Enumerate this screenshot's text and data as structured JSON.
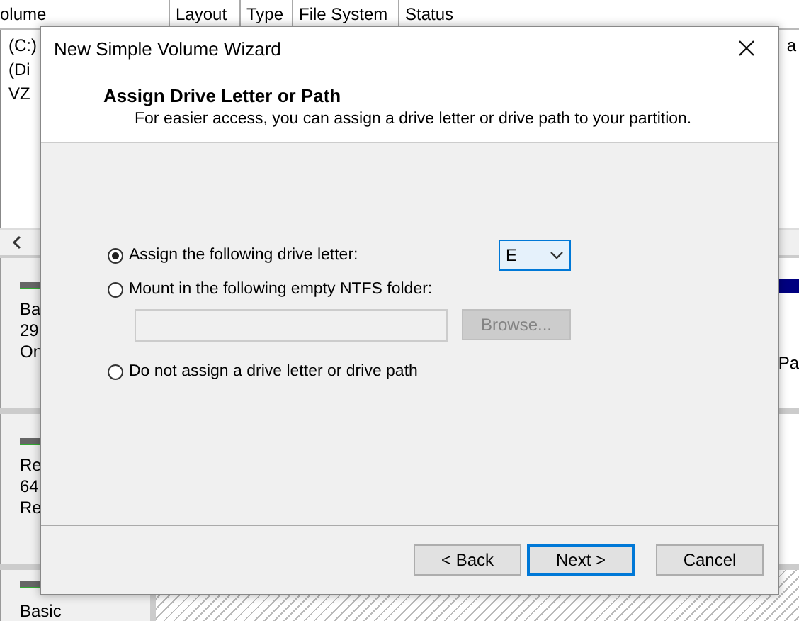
{
  "background": {
    "columns": [
      "olume",
      "Layout",
      "Type",
      "File System",
      "Status"
    ],
    "volumes": [
      {
        "name": "(C:)",
        "tail": "a"
      },
      {
        "name": "(Di"
      },
      {
        "name": "VZ"
      }
    ],
    "disks": [
      {
        "lines": [
          "Ba",
          "29",
          "On"
        ],
        "partition": "Pa"
      },
      {
        "lines": [
          "Re",
          "64",
          "Re"
        ]
      },
      {
        "lines": [
          "Basic"
        ]
      }
    ]
  },
  "dialog": {
    "title": "New Simple Volume Wizard",
    "heading": "Assign Drive Letter or Path",
    "subtitle": "For easier access, you can assign a drive letter or drive path to your partition.",
    "options": [
      {
        "kind": "letter",
        "label": "Assign the following drive letter:",
        "selected": true,
        "value": "E"
      },
      {
        "kind": "folder",
        "label": "Mount in the following empty NTFS folder:",
        "selected": false,
        "disabled": true,
        "button": "Browse..."
      },
      {
        "kind": "none",
        "label": "Do not assign a drive letter or drive path",
        "selected": false
      }
    ],
    "buttons": [
      {
        "label": "< Back",
        "default": false
      },
      {
        "label": "Next >",
        "default": true
      },
      {
        "label": "Cancel",
        "default": false
      }
    ]
  }
}
